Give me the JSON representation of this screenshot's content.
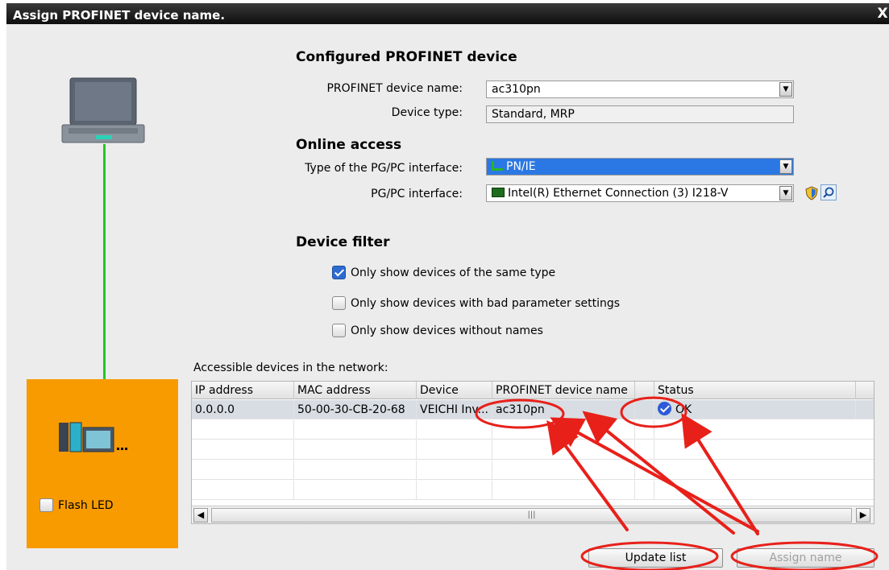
{
  "window": {
    "title": "Assign PROFINET device name.",
    "close_glyph": "X"
  },
  "configured": {
    "heading": "Configured PROFINET device",
    "device_name_label": "PROFINET device name:",
    "device_name_value": "ac310pn",
    "device_type_label": "Device type:",
    "device_type_value": "Standard, MRP"
  },
  "online": {
    "heading": "Online access",
    "interface_type_label": "Type of the PG/PC interface:",
    "interface_type_value": "PN/IE",
    "interface_label": "PG/PC interface:",
    "interface_value": "Intel(R) Ethernet Connection (3) I218-V"
  },
  "filter": {
    "heading": "Device filter",
    "options": [
      {
        "label": "Only show devices of the same type",
        "checked": true
      },
      {
        "label": "Only show devices with bad parameter settings",
        "checked": false
      },
      {
        "label": "Only show devices without names",
        "checked": false
      }
    ]
  },
  "network": {
    "label": "Accessible devices in the network:",
    "columns": [
      "IP address",
      "MAC address",
      "Device",
      "PROFINET device name",
      "",
      "Status"
    ],
    "rows": [
      {
        "ip": "0.0.0.0",
        "mac": "50-00-30-CB-20-68",
        "device": "VEICHI Inv...",
        "name": "ac310pn",
        "status": "OK"
      }
    ]
  },
  "left_panel": {
    "flash_label": "Flash LED",
    "flash_checked": false
  },
  "buttons": {
    "update": "Update list",
    "assign": "Assign name"
  },
  "colors": {
    "link": "#22c922",
    "device_panel": "#f79b00",
    "annotation": "#e8201a",
    "selection": "#2b78e4"
  },
  "icons": [
    "pc-icon",
    "device-icon",
    "network-icon",
    "nic-icon",
    "shield-icon",
    "magnify-icon",
    "ok-check-icon",
    "chevron-down-icon"
  ]
}
